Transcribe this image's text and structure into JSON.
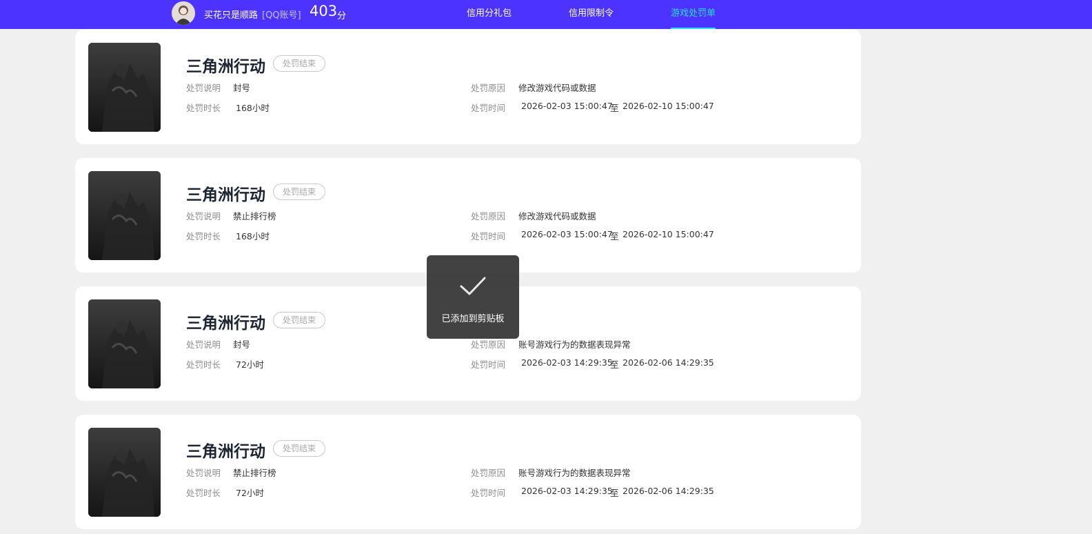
{
  "header": {
    "nickname": "买花只是顺路",
    "account_tag": "[QQ账号]",
    "score": "403",
    "score_unit": "分",
    "tabs": [
      {
        "label": "信用分礼包",
        "active": false
      },
      {
        "label": "信用限制令",
        "active": false
      },
      {
        "label": "游戏处罚单",
        "active": true
      }
    ]
  },
  "colors": {
    "header_bg": "#4c33ff",
    "active_tab": "#29e0ff",
    "page_bg": "#f0f0f0",
    "card_bg": "#ffffff"
  },
  "labels": {
    "desc": "处罚说明",
    "reason": "处罚原因",
    "duration": "处罚时长",
    "time": "处罚时间",
    "range_sep": "至"
  },
  "penalties": [
    {
      "game": "三角洲行动",
      "status": "处罚结束",
      "desc": "封号",
      "reason": "修改游戏代码或数据",
      "duration": "168小时",
      "start": "2026-02-03 15:00:47",
      "end": "2026-02-10 15:00:47"
    },
    {
      "game": "三角洲行动",
      "status": "处罚结束",
      "desc": "禁止排行榜",
      "reason": "修改游戏代码或数据",
      "duration": "168小时",
      "start": "2026-02-03 15:00:47",
      "end": "2026-02-10 15:00:47"
    },
    {
      "game": "三角洲行动",
      "status": "处罚结束",
      "desc": "封号",
      "reason": "账号游戏行为的数据表现异常",
      "duration": "72小时",
      "start": "2026-02-03 14:29:35",
      "end": "2026-02-06 14:29:35"
    },
    {
      "game": "三角洲行动",
      "status": "处罚结束",
      "desc": "禁止排行榜",
      "reason": "账号游戏行为的数据表现异常",
      "duration": "72小时",
      "start": "2026-02-03 14:29:35",
      "end": "2026-02-06 14:29:35"
    }
  ],
  "toast": {
    "icon": "check-icon",
    "text": "已添加到剪贴板"
  }
}
